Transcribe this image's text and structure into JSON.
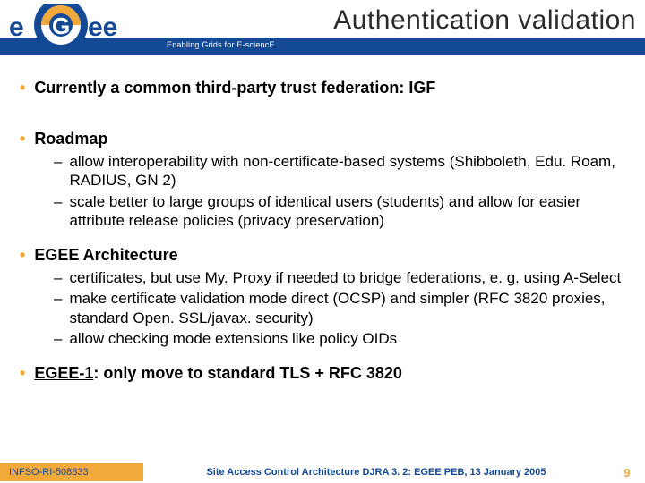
{
  "header": {
    "title": "Authentication validation",
    "tagline": "Enabling Grids for E-sciencE",
    "logo_text": "eGee"
  },
  "bullets": {
    "b1": "Currently a common third-party trust federation: IGF",
    "b2": "Roadmap",
    "b2_items": [
      "allow interoperability with non-certificate-based systems (Shibboleth, Edu. Roam, RADIUS, GN 2)",
      "scale better to large groups of identical users (students) and allow for easier attribute release policies (privacy preservation)"
    ],
    "b3": "EGEE Architecture",
    "b3_items": [
      "certificates, but use My. Proxy if needed to bridge federations, e. g. using A-Select",
      "make certificate validation mode direct (OCSP) and simpler (RFC 3820 proxies, standard Open. SSL/javax. security)",
      "allow checking mode extensions like policy OIDs"
    ],
    "b4_prefix": "EGEE-1",
    "b4_rest": ": only move to standard TLS + RFC 3820"
  },
  "footer": {
    "left": "INFSO-RI-508833",
    "center": "Site Access Control Architecture DJRA 3. 2: EGEE PEB, 13 January 2005",
    "page": "9"
  }
}
